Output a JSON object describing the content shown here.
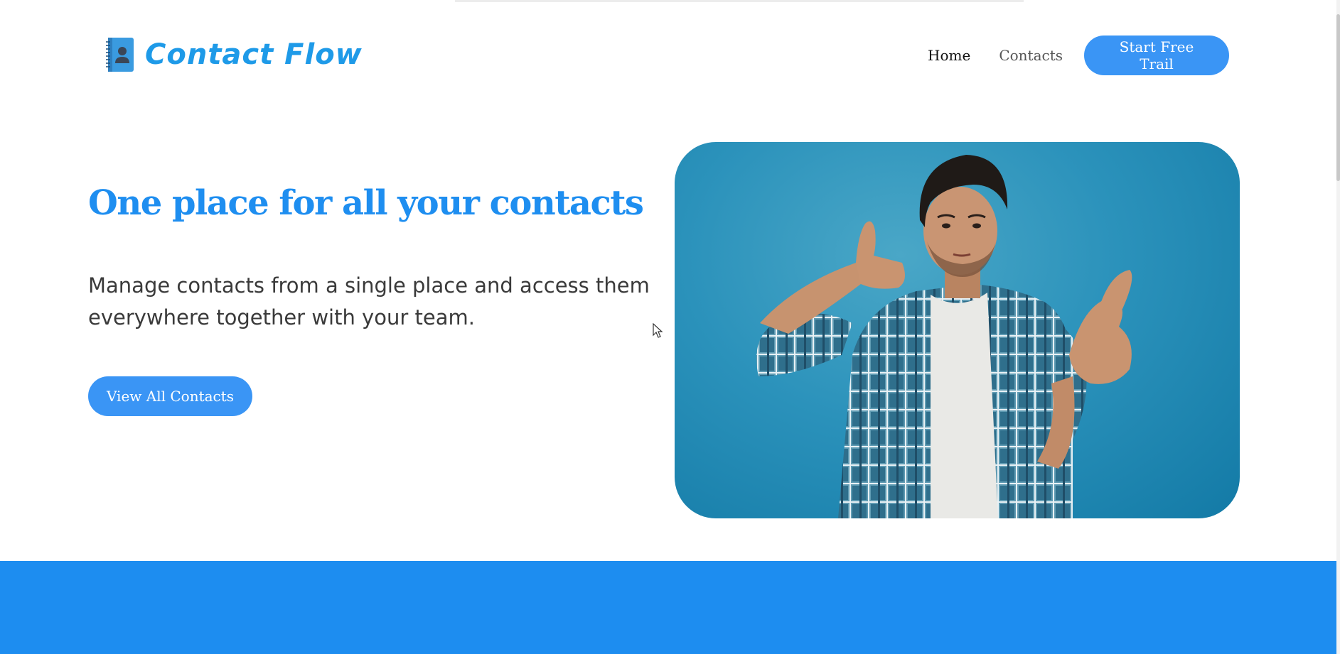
{
  "brand": {
    "name": "Contact Flow",
    "logo_icon": "contact-book-icon",
    "color": "#1e9ae8"
  },
  "nav": {
    "home_label": "Home",
    "contacts_label": "Contacts",
    "cta_label": "Start Free Trail"
  },
  "hero": {
    "title": "One place for all your contacts",
    "description": "Manage contacts from a single place and access them everywhere together with your team.",
    "cta_label": "View All Contacts",
    "image_icon": "man-phone-gesture-photo"
  },
  "colors": {
    "accent": "#3a95f5",
    "title": "#1e8ef0",
    "band": "#1d8df0",
    "photo_background": "#2b92bb"
  }
}
